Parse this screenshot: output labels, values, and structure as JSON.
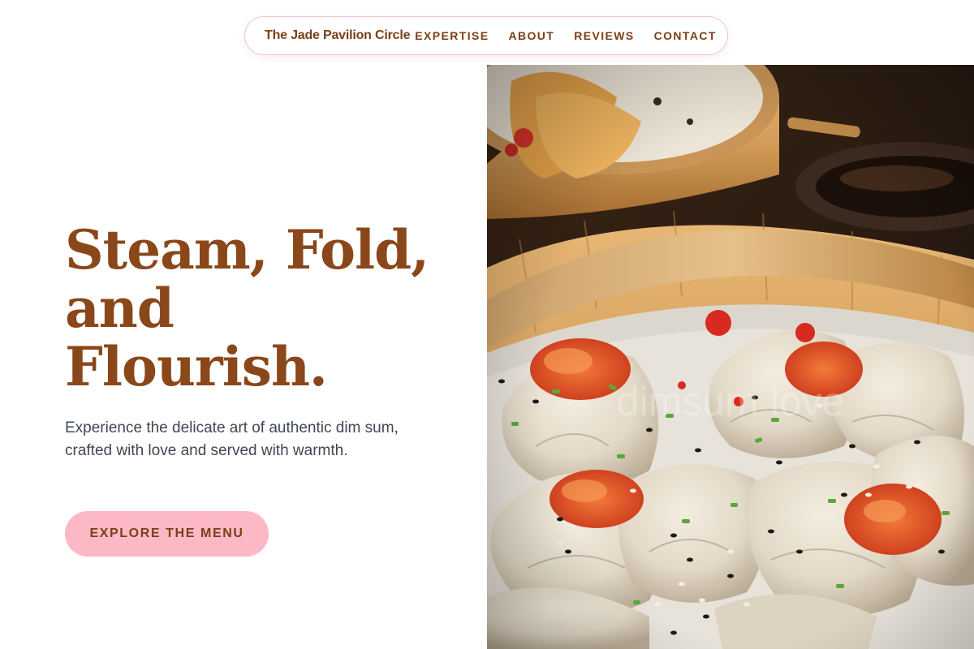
{
  "nav": {
    "brand": "The Jade Pavilion Circle",
    "links": [
      "EXPERTISE",
      "ABOUT",
      "REVIEWS",
      "CONTACT"
    ]
  },
  "hero": {
    "title_lines": [
      "Steam, Fold,",
      "and",
      "Flourish."
    ],
    "subtitle": "Experience the delicate art of authentic dim sum, crafted with love and served with warmth.",
    "cta_label": "EXPLORE THE MENU"
  },
  "image": {
    "watermark": "dimsum love",
    "subject": "steamed dumplings with chili topping in bamboo steamer"
  },
  "colors": {
    "brand_brown": "#8a4719",
    "cta_pink": "#fdb8c6",
    "nav_border": "#f3c3cc",
    "body_text": "#3f4654"
  }
}
